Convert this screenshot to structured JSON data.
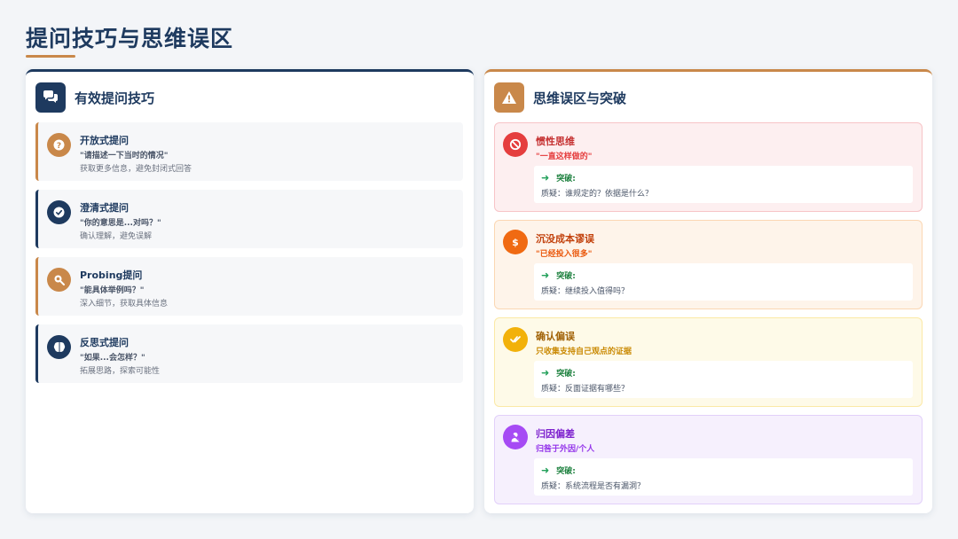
{
  "page": {
    "title": "提问技巧与思维误区"
  },
  "left": {
    "title": "有效提问技巧",
    "items": [
      {
        "title": "开放式提问",
        "quote": "\"请描述一下当时的情况\"",
        "desc": "获取更多信息，避免封闭式回答"
      },
      {
        "title": "澄清式提问",
        "quote": "\"你的意思是...对吗？\"",
        "desc": "确认理解，避免误解"
      },
      {
        "title": "Probing提问",
        "quote": "\"能具体举例吗？\"",
        "desc": "深入细节，获取具体信息"
      },
      {
        "title": "反思式提问",
        "quote": "\"如果...会怎样？\"",
        "desc": "拓展思路，探索可能性"
      }
    ]
  },
  "right": {
    "title": "思维误区与突破",
    "items": [
      {
        "title": "惯性思维",
        "quote": "\"一直这样做的\"",
        "break_label": "突破:",
        "break_text": "质疑：谁规定的？依据是什么？"
      },
      {
        "title": "沉没成本谬误",
        "quote": "\"已经投入很多\"",
        "break_label": "突破:",
        "break_text": "质疑：继续投入值得吗？"
      },
      {
        "title": "确认偏误",
        "quote": "只收集支持自己观点的证据",
        "break_label": "突破:",
        "break_text": "质疑：反面证据有哪些？"
      },
      {
        "title": "归因偏差",
        "quote": "归咎于外因/个人",
        "break_label": "突破:",
        "break_text": "质疑：系统流程是否有漏洞？"
      }
    ]
  },
  "icons": {
    "left_header": "chat-bubbles-icon",
    "right_header": "warning-icon",
    "tips": [
      "question-icon",
      "check-icon",
      "search-icon",
      "brain-icon"
    ],
    "traps": [
      "ban-icon",
      "dollar-icon",
      "check-double-icon",
      "user-slash-icon"
    ],
    "break": "arrow-right-icon"
  },
  "colors": {
    "navy": "#1e3a5f",
    "accent": "#c9884a",
    "trap_inertia": "#e53e3e",
    "trap_sunk": "#f06a12",
    "trap_confirm": "#f2b10a",
    "trap_attribution": "#a64bf4",
    "breakthrough": "#22a05a"
  }
}
